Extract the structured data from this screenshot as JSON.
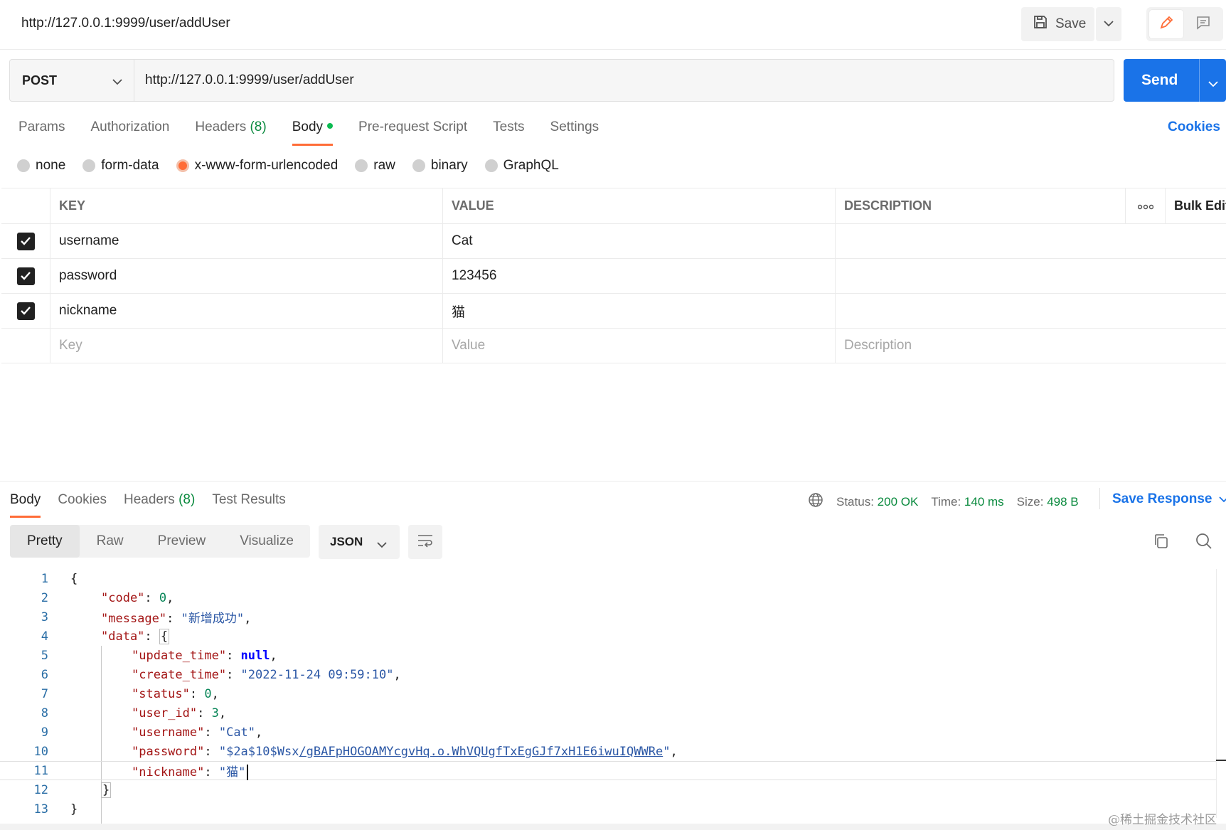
{
  "header": {
    "title": "http://127.0.0.1:9999/user/addUser",
    "save_label": "Save"
  },
  "request": {
    "method": "POST",
    "url": "http://127.0.0.1:9999/user/addUser",
    "send_label": "Send"
  },
  "request_tabs": {
    "params": "Params",
    "authorization": "Authorization",
    "headers": "Headers",
    "headers_count": "(8)",
    "body": "Body",
    "pre_request": "Pre-request Script",
    "tests": "Tests",
    "settings": "Settings",
    "cookies": "Cookies"
  },
  "body_types": {
    "none": "none",
    "form_data": "form-data",
    "urlencoded": "x-www-form-urlencoded",
    "raw": "raw",
    "binary": "binary",
    "graphql": "GraphQL",
    "selected": "x-www-form-urlencoded"
  },
  "params_table": {
    "headers": {
      "key": "KEY",
      "value": "VALUE",
      "description": "DESCRIPTION",
      "bulk_edit": "Bulk Edit"
    },
    "rows": [
      {
        "key": "username",
        "value": "Cat",
        "description": ""
      },
      {
        "key": "password",
        "value": "123456",
        "description": ""
      },
      {
        "key": "nickname",
        "value": "猫",
        "description": ""
      }
    ],
    "placeholders": {
      "key": "Key",
      "value": "Value",
      "description": "Description"
    }
  },
  "response": {
    "tabs": {
      "body": "Body",
      "cookies": "Cookies",
      "headers": "Headers",
      "headers_count": "(8)",
      "test_results": "Test Results"
    },
    "status_label": "Status:",
    "status_value": "200 OK",
    "time_label": "Time:",
    "time_value": "140 ms",
    "size_label": "Size:",
    "size_value": "498 B",
    "save_response": "Save Response",
    "views": {
      "pretty": "Pretty",
      "raw": "Raw",
      "preview": "Preview",
      "visualize": "Visualize"
    },
    "format": "JSON"
  },
  "code_lines": {
    "l1": "1",
    "l2": "2",
    "l3": "3",
    "l4": "4",
    "l5": "5",
    "l6": "6",
    "l7": "7",
    "l8": "8",
    "l9": "9",
    "l10": "10",
    "l11": "11",
    "l12": "12",
    "l13": "13",
    "brace_open": "{",
    "brace_close": "}",
    "code_key": "\"code\"",
    "code_val": "0",
    "message_key": "\"message\"",
    "message_val": "\"新增成功\"",
    "data_key": "\"data\"",
    "update_time_key": "\"update_time\"",
    "update_time_val": "null",
    "create_time_key": "\"create_time\"",
    "create_time_val": "\"2022-11-24 09:59:10\"",
    "status_key": "\"status\"",
    "status_val": "0",
    "user_id_key": "\"user_id\"",
    "user_id_val": "3",
    "username_key": "\"username\"",
    "username_val": "\"Cat\"",
    "password_key": "\"password\"",
    "password_val_prefix": "\"$2a$10$Wsx",
    "password_val_link": "/gBAFpHOGOAMYcgvHq.o.WhVQUgfTxEgGJf7xH1E6iwuIQWWRe",
    "password_val_suffix": "\"",
    "nickname_key": "\"nickname\"",
    "nickname_val": "\"猫\""
  },
  "watermark": "@稀土掘金技术社区",
  "colors": {
    "accent_orange": "#ff6c37",
    "send_blue": "#1a73e8",
    "status_green": "#0a8a3e"
  },
  "icons": [
    "save-icon",
    "chevron-down-icon",
    "pencil-icon",
    "comment-icon",
    "globe-icon",
    "wrap-icon",
    "copy-icon",
    "search-icon",
    "checkmark-icon",
    "more-dots-icon"
  ]
}
